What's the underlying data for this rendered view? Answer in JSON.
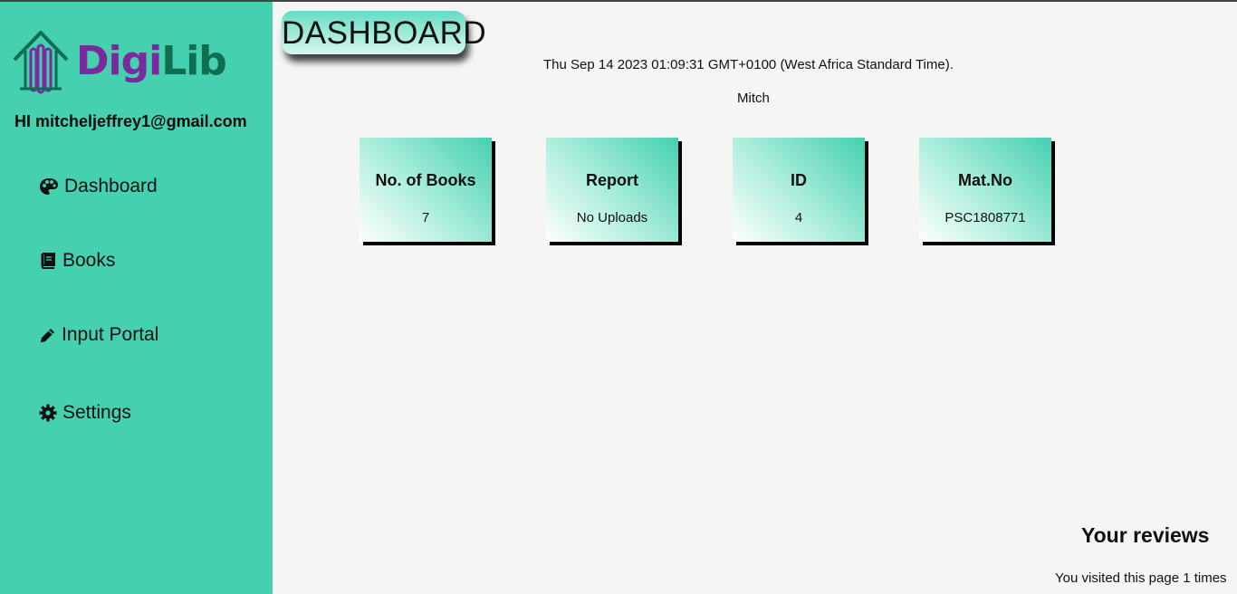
{
  "sidebar": {
    "logo": {
      "part1": "Digi",
      "part2": "Lib"
    },
    "greeting": "HI mitcheljeffrey1@gmail.com",
    "items": [
      {
        "label": "Dashboard",
        "icon": "palette-icon"
      },
      {
        "label": "Books",
        "icon": "book-icon"
      },
      {
        "label": "Input Portal",
        "icon": "pencil-icon"
      },
      {
        "label": "Settings",
        "icon": "gear-icon"
      }
    ]
  },
  "main": {
    "title": "DASHBOARD",
    "datetime": "Thu Sep 14 2023 01:09:31 GMT+0100 (West Africa Standard Time).",
    "username": "Mitch",
    "cards": [
      {
        "title": "No. of Books",
        "value": "7"
      },
      {
        "title": "Report",
        "value": "No Uploads"
      },
      {
        "title": "ID",
        "value": "4"
      },
      {
        "title": "Mat.No",
        "value": "PSC1808771"
      }
    ],
    "reviews_title": "Your reviews",
    "visits_text": "You visited this page 1 times"
  },
  "colors": {
    "sidebar_bg": "#45d0b0",
    "page_bg": "#f5f5f5",
    "logo_purple": "#7a2a9c",
    "logo_green": "#0e6e4f"
  }
}
